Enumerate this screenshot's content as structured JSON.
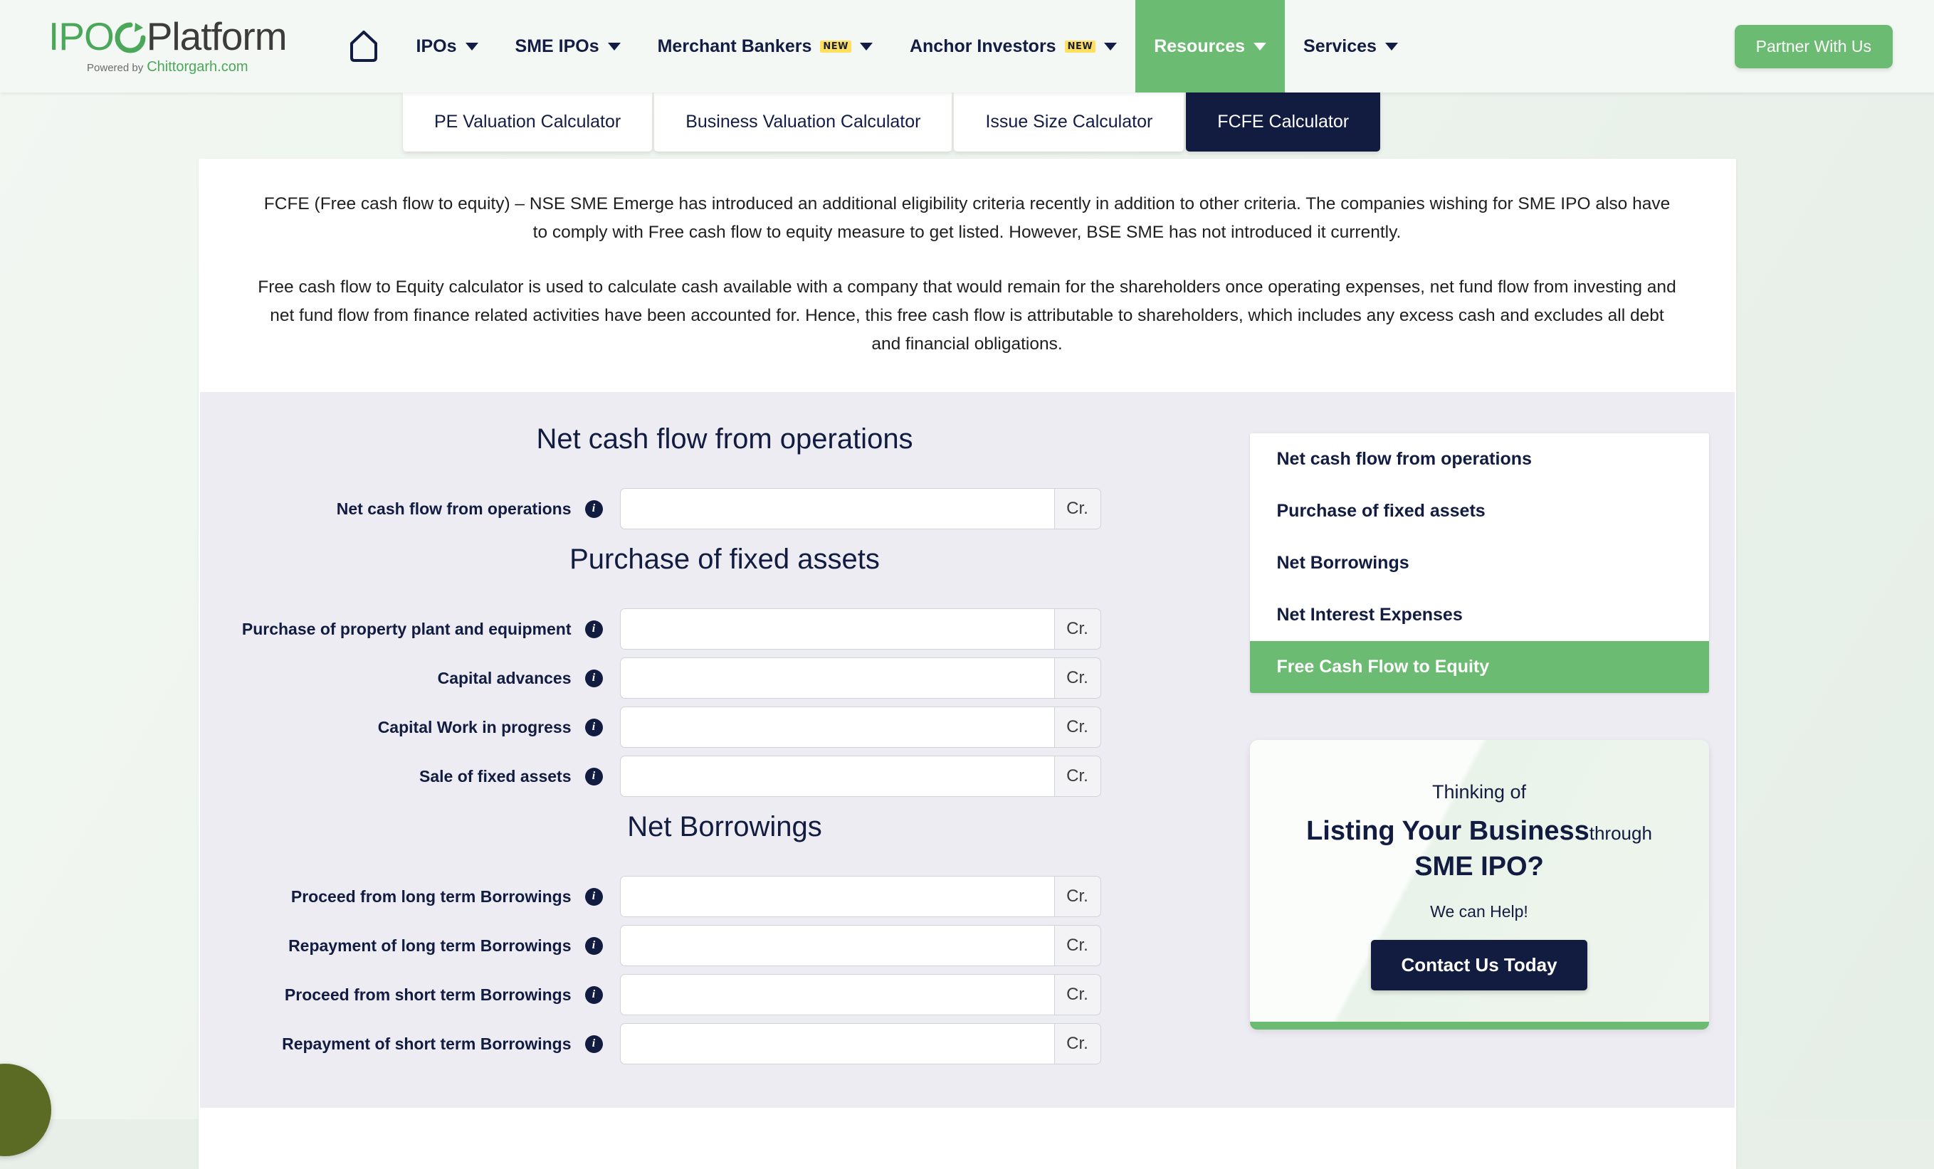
{
  "brand": {
    "logo_ipo": "IPO",
    "logo_platform": "Platform",
    "powered_by": "Powered by",
    "powered_by_site": "Chittorgarh.com",
    "accent_green": "#6cbb72",
    "accent_navy": "#121c41",
    "badge_yellow": "#ffdf5c"
  },
  "header": {
    "home_icon": "home-icon",
    "nav": [
      {
        "label": "IPOs",
        "has_caret": true,
        "badge": "",
        "active": false
      },
      {
        "label": "SME IPOs",
        "has_caret": true,
        "badge": "",
        "active": false
      },
      {
        "label": "Merchant Bankers",
        "has_caret": true,
        "badge": "NEW",
        "active": false
      },
      {
        "label": "Anchor Investors",
        "has_caret": true,
        "badge": "NEW",
        "active": false
      },
      {
        "label": "Resources",
        "has_caret": true,
        "badge": "",
        "active": true
      },
      {
        "label": "Services",
        "has_caret": true,
        "badge": "",
        "active": false
      }
    ],
    "partner_button": "Partner With Us"
  },
  "tabs": [
    {
      "label": "PE Valuation Calculator",
      "active": false
    },
    {
      "label": "Business Valuation Calculator",
      "active": false
    },
    {
      "label": "Issue Size Calculator",
      "active": false
    },
    {
      "label": "FCFE Calculator",
      "active": true
    }
  ],
  "intro": {
    "paragraph1": "FCFE (Free cash flow to equity) – NSE SME Emerge has introduced an additional eligibility criteria recently in addition to other criteria. The companies wishing for SME IPO also have to comply with Free cash flow to equity measure to get listed. However, BSE SME has not introduced it currently.",
    "paragraph2": "Free cash flow to Equity calculator is used to calculate cash available with a company that would remain for the shareholders once operating expenses, net fund flow from investing and net fund flow from finance related activities have been accounted for. Hence, this free cash flow is attributable to shareholders, which includes any excess cash and excludes all debt and financial obligations."
  },
  "form": {
    "currency_addon": "Cr.",
    "input_placeholder": "",
    "sections": [
      {
        "title": "Net cash flow from operations",
        "fields": [
          {
            "label": "Net cash flow from operations",
            "value": "",
            "info": "info-icon"
          }
        ]
      },
      {
        "title": "Purchase of fixed assets",
        "fields": [
          {
            "label": "Purchase of property plant and equipment",
            "value": "",
            "info": "info-icon"
          },
          {
            "label": "Capital advances",
            "value": "",
            "info": "info-icon"
          },
          {
            "label": "Capital Work in progress",
            "value": "",
            "info": "info-icon"
          },
          {
            "label": "Sale of fixed assets",
            "value": "",
            "info": "info-icon"
          }
        ]
      },
      {
        "title": "Net Borrowings",
        "fields": [
          {
            "label": "Proceed from long term Borrowings",
            "value": "",
            "info": "info-icon"
          },
          {
            "label": "Repayment of long term Borrowings",
            "value": "",
            "info": "info-icon"
          },
          {
            "label": "Proceed from short term Borrowings",
            "value": "",
            "info": "info-icon"
          },
          {
            "label": "Repayment of short term Borrowings",
            "value": "",
            "info": "info-icon"
          }
        ]
      }
    ]
  },
  "sidebar": {
    "items": [
      {
        "label": "Net cash flow from operations",
        "active": false
      },
      {
        "label": "Purchase of fixed assets",
        "active": false
      },
      {
        "label": "Net Borrowings",
        "active": false
      },
      {
        "label": "Net Interest Expenses",
        "active": false
      },
      {
        "label": "Free Cash Flow to Equity",
        "active": true
      }
    ]
  },
  "promo": {
    "line1": "Thinking of",
    "line2_strong": "Listing Your Business",
    "line2_tail": "through",
    "line3": "SME IPO?",
    "line4": "We can Help!",
    "cta": "Contact Us Today"
  }
}
